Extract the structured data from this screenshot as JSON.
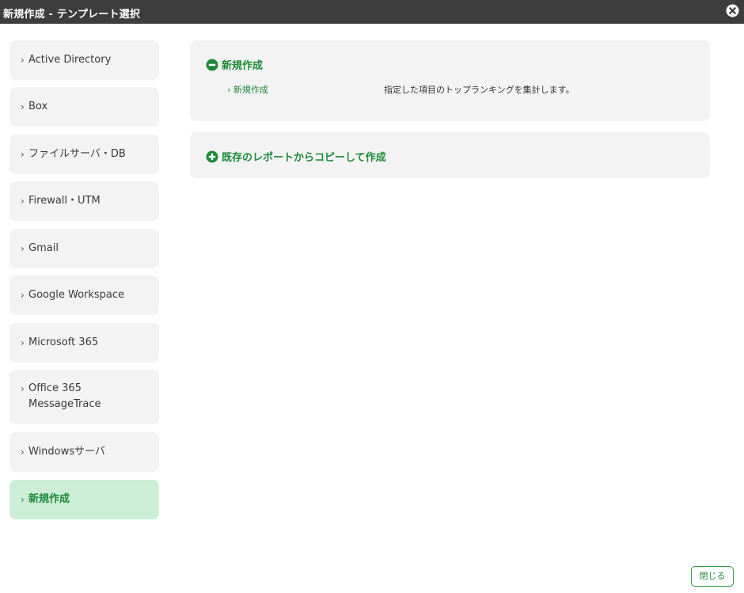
{
  "window": {
    "title": "新規作成 - テンプレート選択",
    "close_icon": "close-circle-icon"
  },
  "sidebar": {
    "items": [
      {
        "label": "Active Directory"
      },
      {
        "label": "Box"
      },
      {
        "label": "ファイルサーバ・DB"
      },
      {
        "label": "Firewall・UTM"
      },
      {
        "label": "Gmail"
      },
      {
        "label": "Google Workspace"
      },
      {
        "label": "Microsoft 365"
      },
      {
        "label": "Office 365 MessageTrace",
        "line1": "Office 365",
        "line2": "MessageTrace"
      },
      {
        "label": "Windowsサーバ"
      },
      {
        "label": "新規作成",
        "active": true
      }
    ]
  },
  "main": {
    "sections": [
      {
        "title": "新規作成",
        "expanded": true,
        "icon": "minus-circle-icon",
        "templates": [
          {
            "name": "新規作成",
            "description": "指定した項目のトップランキングを集計します。"
          }
        ]
      },
      {
        "title": "既存のレポートからコピーして作成",
        "expanded": false,
        "icon": "plus-circle-icon"
      }
    ]
  },
  "footer": {
    "close_label": "閉じる"
  },
  "colors": {
    "titlebar": "#3d3d3d",
    "accent": "#1f8a3a",
    "active_bg": "#cdeed6",
    "panel_bg": "#f3f3f3"
  }
}
